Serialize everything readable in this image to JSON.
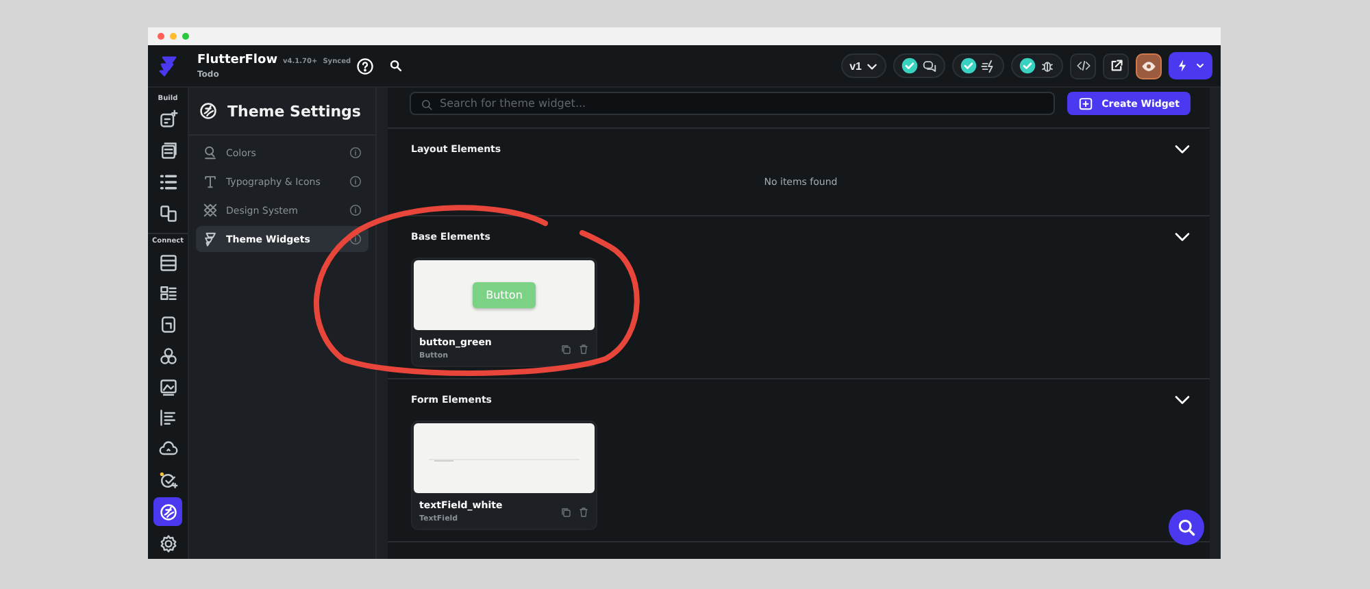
{
  "app": {
    "name": "FlutterFlow",
    "version": "v4.1.70+",
    "sync_status": "Synced",
    "project": "Todo"
  },
  "toolbar": {
    "version": "v1",
    "checks": [
      {
        "passed": true
      },
      {
        "passed": true
      },
      {
        "passed": true
      }
    ],
    "preview_selected": true
  },
  "rail": [
    {
      "kind": "label",
      "label": "Build"
    },
    {
      "kind": "icon",
      "selected": false
    },
    {
      "kind": "icon",
      "selected": false
    },
    {
      "kind": "icon",
      "selected": false
    },
    {
      "kind": "icon",
      "selected": false
    },
    {
      "kind": "label",
      "label": "Connect"
    },
    {
      "kind": "icon",
      "selected": false
    },
    {
      "kind": "icon",
      "selected": false
    },
    {
      "kind": "icon",
      "selected": false
    },
    {
      "kind": "icon",
      "selected": false
    },
    {
      "kind": "icon",
      "selected": false
    },
    {
      "kind": "icon",
      "selected": false
    },
    {
      "kind": "icon",
      "selected": false
    },
    {
      "kind": "icon",
      "selected": false
    },
    {
      "kind": "icon",
      "selected": true
    },
    {
      "kind": "icon",
      "selected": false
    }
  ],
  "panel": {
    "title": "Theme Settings",
    "items": [
      {
        "label": "Colors",
        "selected": false
      },
      {
        "label": "Typography & Icons",
        "selected": false
      },
      {
        "label": "Design System",
        "selected": false
      },
      {
        "label": "Theme Widgets",
        "selected": true
      }
    ]
  },
  "content": {
    "search": {
      "placeholder": "Search for theme widget..."
    },
    "create_button": "Create Widget",
    "sections": [
      {
        "title": "Layout Elements",
        "expanded": true,
        "empty_text": "No items found"
      },
      {
        "title": "Base Elements",
        "expanded": true,
        "widgets": [
          {
            "kind": "button",
            "name": "button_green",
            "type": "Button",
            "preview_label": "Button"
          }
        ]
      },
      {
        "title": "Form Elements",
        "expanded": true,
        "widgets": [
          {
            "kind": "textfield",
            "name": "textField_white",
            "type": "TextField"
          }
        ]
      }
    ]
  }
}
